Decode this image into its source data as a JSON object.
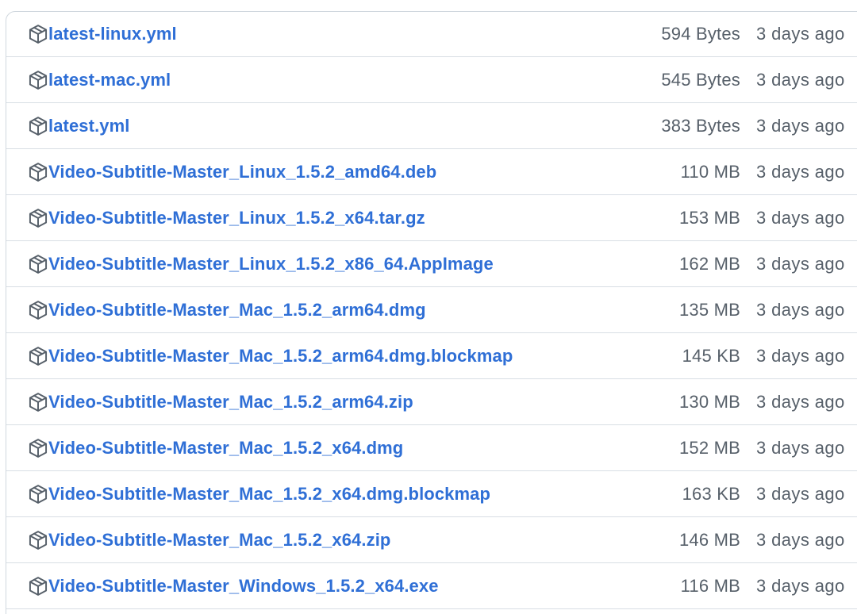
{
  "assets": [
    {
      "name": "latest-linux.yml",
      "size": "594 Bytes",
      "date": "3 days ago",
      "icon": "package-icon"
    },
    {
      "name": "latest-mac.yml",
      "size": "545 Bytes",
      "date": "3 days ago",
      "icon": "package-icon"
    },
    {
      "name": "latest.yml",
      "size": "383 Bytes",
      "date": "3 days ago",
      "icon": "package-icon"
    },
    {
      "name": "Video-Subtitle-Master_Linux_1.5.2_amd64.deb",
      "size": "110 MB",
      "date": "3 days ago",
      "icon": "package-icon"
    },
    {
      "name": "Video-Subtitle-Master_Linux_1.5.2_x64.tar.gz",
      "size": "153 MB",
      "date": "3 days ago",
      "icon": "package-icon"
    },
    {
      "name": "Video-Subtitle-Master_Linux_1.5.2_x86_64.AppImage",
      "size": "162 MB",
      "date": "3 days ago",
      "icon": "package-icon"
    },
    {
      "name": "Video-Subtitle-Master_Mac_1.5.2_arm64.dmg",
      "size": "135 MB",
      "date": "3 days ago",
      "icon": "package-icon"
    },
    {
      "name": "Video-Subtitle-Master_Mac_1.5.2_arm64.dmg.blockmap",
      "size": "145 KB",
      "date": "3 days ago",
      "icon": "package-icon"
    },
    {
      "name": "Video-Subtitle-Master_Mac_1.5.2_arm64.zip",
      "size": "130 MB",
      "date": "3 days ago",
      "icon": "package-icon"
    },
    {
      "name": "Video-Subtitle-Master_Mac_1.5.2_x64.dmg",
      "size": "152 MB",
      "date": "3 days ago",
      "icon": "package-icon"
    },
    {
      "name": "Video-Subtitle-Master_Mac_1.5.2_x64.dmg.blockmap",
      "size": "163 KB",
      "date": "3 days ago",
      "icon": "package-icon"
    },
    {
      "name": "Video-Subtitle-Master_Mac_1.5.2_x64.zip",
      "size": "146 MB",
      "date": "3 days ago",
      "icon": "package-icon"
    },
    {
      "name": "Video-Subtitle-Master_Windows_1.5.2_x64.exe",
      "size": "116 MB",
      "date": "3 days ago",
      "icon": "package-icon"
    }
  ],
  "colors": {
    "link": "#2f6fd6",
    "muted_text": "#57606a",
    "border": "#d0d7de",
    "icon": "#57606a"
  }
}
